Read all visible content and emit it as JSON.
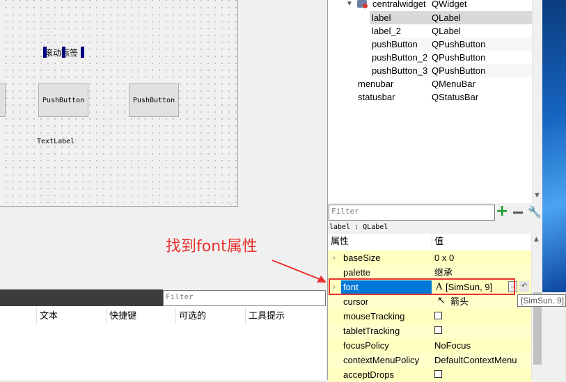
{
  "form": {
    "label_cn": "滚动标签",
    "pushbutton1": "PushButton",
    "pushbutton2": "PushButton",
    "textlabel": "TextLabel"
  },
  "object_tree": {
    "rows": [
      {
        "name": "centralwidget",
        "cls": "QWidget"
      },
      {
        "name": "label",
        "cls": "QLabel"
      },
      {
        "name": "label_2",
        "cls": "QLabel"
      },
      {
        "name": "pushButton",
        "cls": "QPushButton"
      },
      {
        "name": "pushButton_2",
        "cls": "QPushButton"
      },
      {
        "name": "pushButton_3",
        "cls": "QPushButton"
      },
      {
        "name": "menubar",
        "cls": "QMenuBar"
      },
      {
        "name": "statusbar",
        "cls": "QStatusBar"
      }
    ]
  },
  "property_editor": {
    "filter_placeholder": "Filter",
    "object_label": "label : QLabel",
    "col_property": "属性",
    "col_value": "值",
    "rows": [
      {
        "name": "baseSize",
        "value": "0 x 0"
      },
      {
        "name": "palette",
        "value": "继承"
      },
      {
        "name": "font",
        "value": "[SimSun, 9]"
      },
      {
        "name": "cursor",
        "value": "箭头"
      },
      {
        "name": "mouseTracking",
        "value": ""
      },
      {
        "name": "tabletTracking",
        "value": ""
      },
      {
        "name": "focusPolicy",
        "value": "NoFocus"
      },
      {
        "name": "contextMenuPolicy",
        "value": "DefaultContextMenu"
      },
      {
        "name": "acceptDrops",
        "value": ""
      }
    ],
    "font_more_button": "..",
    "tooltip": "[SimSun, 9]"
  },
  "annotation": {
    "text": "找到font属性",
    "color": "#e8322f"
  },
  "action_editor": {
    "filter_placeholder": "Filter",
    "columns": [
      "文本",
      "快捷键",
      "可选的",
      "工具提示"
    ]
  }
}
